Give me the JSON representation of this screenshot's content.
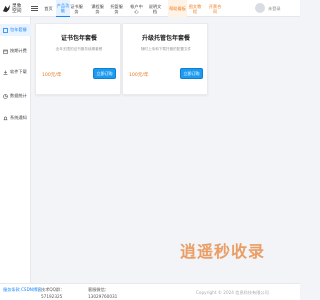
{
  "brand": {
    "name": "灵象空间"
  },
  "nav": {
    "items": [
      {
        "label": "首页"
      },
      {
        "label": "产品功能"
      },
      {
        "label": "证书服务"
      },
      {
        "label": "课程服务"
      },
      {
        "label": "托管服务"
      },
      {
        "label": "帐户中心"
      },
      {
        "label": "说明文档"
      },
      {
        "label": "帮助看板"
      },
      {
        "label": "图文教程"
      },
      {
        "label": "开票合同"
      }
    ]
  },
  "user": {
    "name": "未登录"
  },
  "sidebar": {
    "items": [
      {
        "label": "包年套餐",
        "icon": "package-icon"
      },
      {
        "label": "按期计费",
        "icon": "calendar-icon"
      },
      {
        "label": "软件下载",
        "icon": "download-icon"
      },
      {
        "label": "数据统计",
        "icon": "chart-icon"
      },
      {
        "label": "系统通知",
        "icon": "bell-icon"
      }
    ]
  },
  "cards": [
    {
      "title": "证书包年套餐",
      "desc": "全年无限的证书服务续期套餐",
      "price": "100元/年",
      "button": "立即订购"
    },
    {
      "title": "升级托管包年套餐",
      "desc": "随时上传和下载托管的配置文件",
      "price": "100元/年",
      "button": "立即订购"
    }
  ],
  "footer": {
    "links": [
      "服务条款",
      "CSDN博客"
    ],
    "qq_label": "技术QQ群：",
    "qq_value": "57192325",
    "service_label": "客服微信：",
    "service_value": "13029760031"
  },
  "watermark": {
    "text": "逍遥秒收录",
    "sub": "Copyright © 2024 信息科技有限公司"
  },
  "colors": {
    "primary": "#1684fc",
    "accent": "#e8791e",
    "button": "#1d9bf0"
  }
}
